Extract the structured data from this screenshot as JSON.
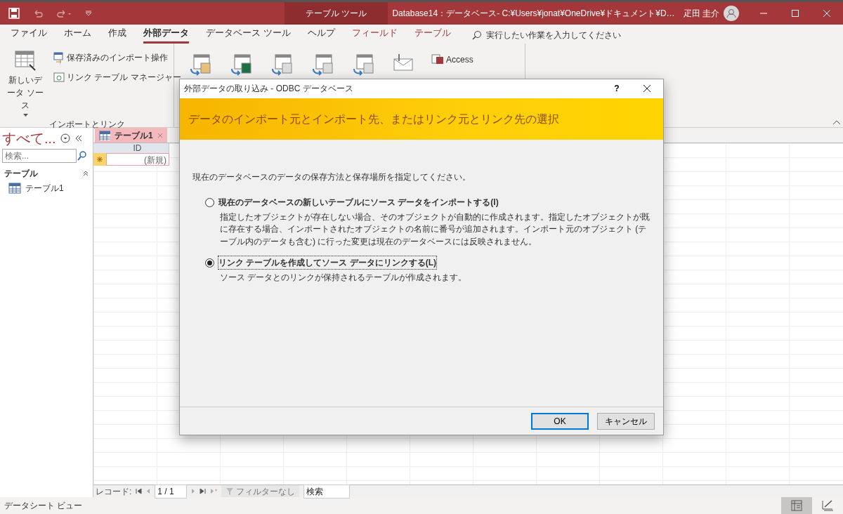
{
  "title_bar": {
    "context_tab": "テーブル ツール",
    "title": "Database14：データベース- C:¥Users¥jonat¥OneDrive¥ドキュメント¥D…",
    "user": "疋田 圭介"
  },
  "ribbon_tabs": [
    {
      "label": "ファイル",
      "selected": false,
      "kind": "normal"
    },
    {
      "label": "ホーム",
      "selected": false,
      "kind": "normal"
    },
    {
      "label": "作成",
      "selected": false,
      "kind": "normal"
    },
    {
      "label": "外部データ",
      "selected": true,
      "kind": "normal"
    },
    {
      "label": "データベース ツール",
      "selected": false,
      "kind": "normal"
    },
    {
      "label": "ヘルプ",
      "selected": false,
      "kind": "normal"
    },
    {
      "label": "フィールド",
      "selected": false,
      "kind": "contextual"
    },
    {
      "label": "テーブル",
      "selected": false,
      "kind": "contextual"
    }
  ],
  "tell_me": {
    "placeholder": "実行したい作業を入力してください"
  },
  "ribbon": {
    "new_source": "新しいデータ ソース",
    "saved_imports": "保存済みのインポート操作",
    "linked_table_manager": "リンク テーブル マネージャー",
    "group_label": "インポートとリンク",
    "access": "Access"
  },
  "nav_pane": {
    "title": "すべて...",
    "search": {
      "placeholder": "検索..."
    },
    "section": "テーブル",
    "items": [
      "テーブル1"
    ]
  },
  "document": {
    "tab": "テーブル1",
    "columns": [
      "ID"
    ],
    "new_row": "(新規)"
  },
  "record_nav": {
    "label": "レコード:",
    "position": "1 / 1",
    "filter": "フィルターなし",
    "search": "検索"
  },
  "status_bar": {
    "view": "データシート ビュー"
  },
  "dialog": {
    "title": "外部データの取り込み - ODBC データベース",
    "help": "?",
    "heading": "データのインポート元とインポート先、またはリンク元とリンク先の選択",
    "prompt": "現在のデータベースのデータの保存方法と保存場所を指定してください。",
    "options": [
      {
        "label": "現在のデータベースの新しいテーブルにソース データをインポートする(I)",
        "description": "指定したオブジェクトが存在しない場合、そのオブジェクトが自動的に作成されます。指定したオブジェクトが既に存在する場合、インポートされたオブジェクトの名前に番号が追加されます。インポート元のオブジェクト (テーブル内のデータも含む) に行った変更は現在のデータベースには反映されません。",
        "selected": false
      },
      {
        "label": "リンク テーブルを作成してソース データにリンクする(L)",
        "description": "ソース データとのリンクが保持されるテーブルが作成されます。",
        "selected": true
      }
    ],
    "buttons": [
      {
        "label": "OK",
        "default": true
      },
      {
        "label": "キャンセル",
        "default": false
      }
    ]
  }
}
